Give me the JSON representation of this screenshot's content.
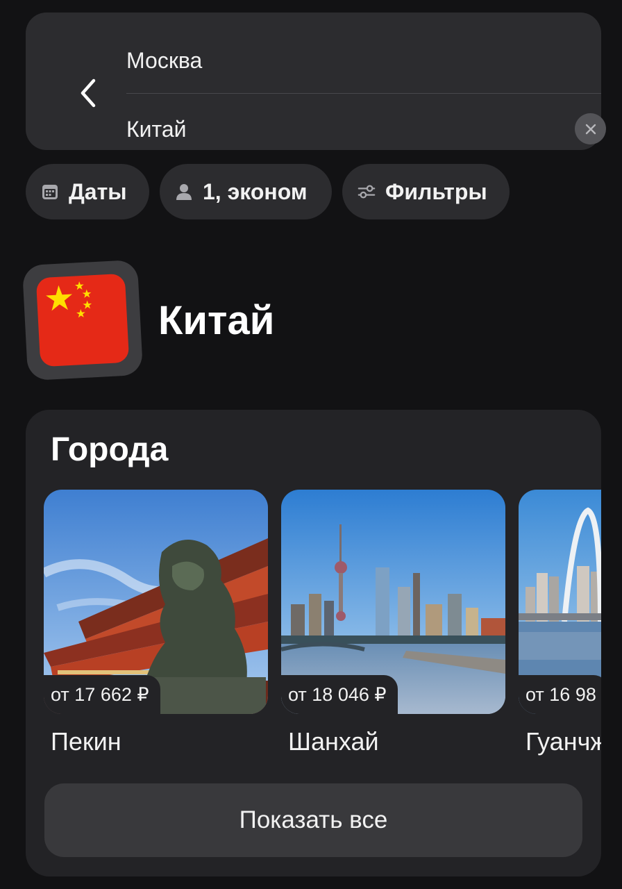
{
  "search": {
    "from": "Москва",
    "to": "Китай"
  },
  "chips": [
    {
      "label": "Даты",
      "icon": "calendar-icon"
    },
    {
      "label": "1, эконом",
      "icon": "person-icon"
    },
    {
      "label": "Фильтры",
      "icon": "filter-sliders-icon"
    }
  ],
  "country": {
    "name": "Китай",
    "flag": "china-flag"
  },
  "cities_section": {
    "title": "Города",
    "cities": [
      {
        "name": "Пекин",
        "price": "от 17 662 ₽"
      },
      {
        "name": "Шанхай",
        "price": "от 18 046 ₽"
      },
      {
        "name": "Гуанчжоу",
        "price": "от 16 98"
      }
    ],
    "show_all_label": "Показать все"
  },
  "colors": {
    "background": "#121214",
    "card": "#2c2c2f",
    "section_card": "#232326",
    "button": "#39393c",
    "flag_red": "#e52917",
    "flag_yellow": "#ffde00"
  }
}
